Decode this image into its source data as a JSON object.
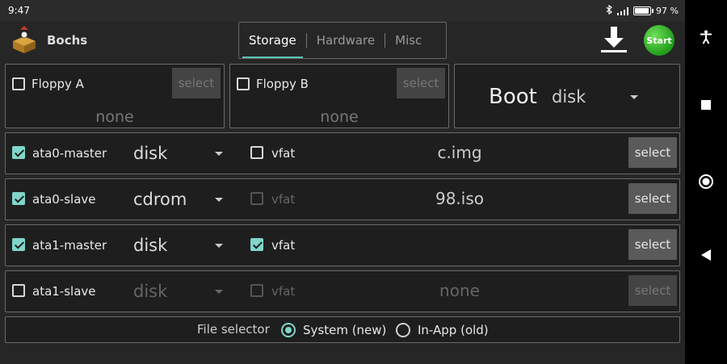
{
  "status": {
    "time": "9:47",
    "battery": "97 %"
  },
  "app": {
    "title": "Bochs"
  },
  "tabs": [
    {
      "label": "Storage",
      "active": true
    },
    {
      "label": "Hardware",
      "active": false
    },
    {
      "label": "Misc",
      "active": false
    }
  ],
  "toolbar": {
    "start_label": "Start",
    "download_icon": "download-icon"
  },
  "floppy": [
    {
      "label": "Floppy A",
      "checked": false,
      "button": "select",
      "file": "none"
    },
    {
      "label": "Floppy B",
      "checked": false,
      "button": "select",
      "file": "none"
    }
  ],
  "boot": {
    "label": "Boot",
    "value": "disk"
  },
  "drives": [
    {
      "label": "ata0-master",
      "checked": true,
      "type": "disk",
      "vfat_label": "vfat",
      "vfat_checked": false,
      "vfat_enabled": true,
      "file": "c.img",
      "button": "select",
      "enabled": true
    },
    {
      "label": "ata0-slave",
      "checked": true,
      "type": "cdrom",
      "vfat_label": "vfat",
      "vfat_checked": false,
      "vfat_enabled": false,
      "file": "98.iso",
      "button": "select",
      "enabled": true
    },
    {
      "label": "ata1-master",
      "checked": true,
      "type": "disk",
      "vfat_label": "vfat",
      "vfat_checked": true,
      "vfat_enabled": true,
      "file": "",
      "button": "select",
      "enabled": true
    },
    {
      "label": "ata1-slave",
      "checked": false,
      "type": "disk",
      "vfat_label": "vfat",
      "vfat_checked": false,
      "vfat_enabled": false,
      "file": "none",
      "button": "select",
      "enabled": false
    }
  ],
  "file_selector": {
    "label": "File selector",
    "options": [
      {
        "label": "System (new)",
        "selected": true
      },
      {
        "label": "In-App (old)",
        "selected": false
      }
    ]
  },
  "colors": {
    "accent": "#7fd6c9",
    "background": "#262626",
    "start": "#2fb82a"
  }
}
